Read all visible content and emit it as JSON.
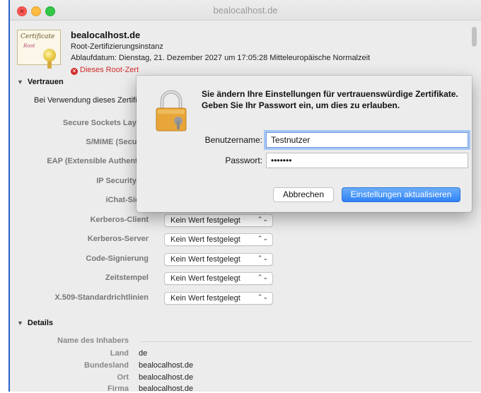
{
  "window": {
    "title": "bealocalhost.de"
  },
  "certificate": {
    "icon_text": "Certificate",
    "icon_subtext": "Root",
    "name": "bealocalhost.de",
    "kind": "Root-Zertifizierungsinstanz",
    "expiry": "Ablaufdatum: Dienstag, 21. Dezember 2027 um 17:05:28 Mitteleuropäische Normalzeit",
    "warning": "Dieses Root-Zert"
  },
  "trust": {
    "heading": "Vertrauen",
    "description": "Bei Verwendung dieses Zertifi",
    "rows": [
      {
        "label": "Secure Sockets Layer (",
        "value": ""
      },
      {
        "label": "S/MIME (Secure I",
        "value": ""
      },
      {
        "label": "EAP (Extensible Authentica",
        "value": ""
      },
      {
        "label": "IP Security (IP",
        "value": ""
      },
      {
        "label": "iChat-Siche",
        "value": ""
      },
      {
        "label": "Kerberos-Client",
        "value": "Kein Wert festgelegt"
      },
      {
        "label": "Kerberos-Server",
        "value": "Kein Wert festgelegt"
      },
      {
        "label": "Code-Signierung",
        "value": "Kein Wert festgelegt"
      },
      {
        "label": "Zeitstempel",
        "value": "Kein Wert festgelegt"
      },
      {
        "label": "X.509-Standardrichtlinien",
        "value": "Kein Wert festgelegt"
      }
    ]
  },
  "details": {
    "heading": "Details",
    "subject_heading": "Name des Inhabers",
    "rows": [
      {
        "label": "Land",
        "value": "de"
      },
      {
        "label": "Bundesland",
        "value": "bealocalhost.de"
      },
      {
        "label": "Ort",
        "value": "bealocalhost.de"
      },
      {
        "label": "Firma",
        "value": "bealocalhost.de"
      }
    ]
  },
  "dialog": {
    "message": "Sie ändern Ihre Einstellungen für vertrauenswürdige Zertifikate. Geben Sie Ihr Passwort ein, um dies zu erlauben.",
    "username_label": "Benutzername:",
    "username_value": "Testnutzer",
    "password_label": "Passwort:",
    "password_value": "•••••••",
    "cancel_label": "Abbrechen",
    "confirm_label": "Einstellungen aktualisieren"
  },
  "colors": {
    "accent": "#2f82f5",
    "warning": "#d12a2a"
  }
}
